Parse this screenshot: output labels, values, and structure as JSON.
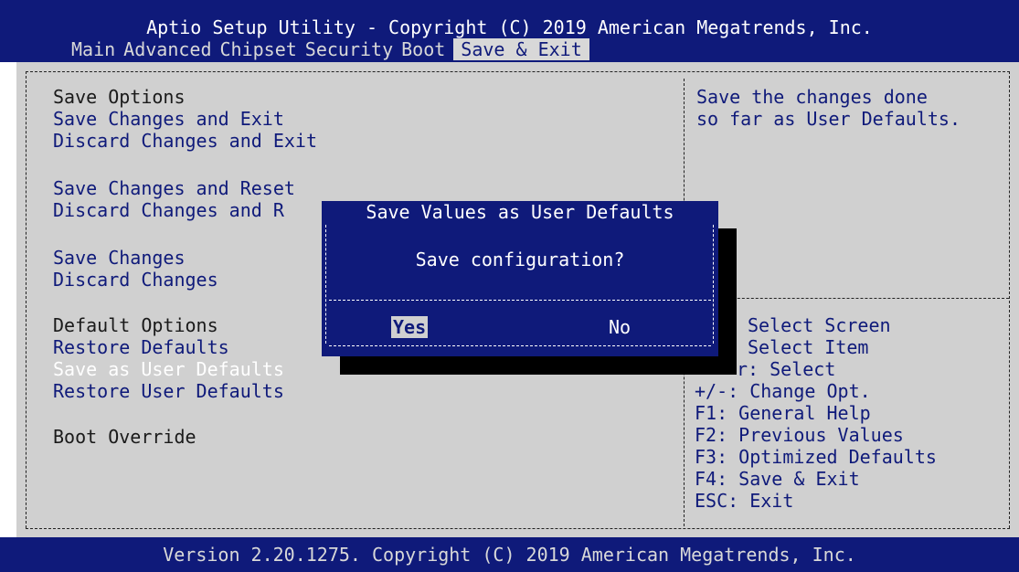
{
  "header": {
    "title": "Aptio Setup Utility - Copyright (C) 2019 American Megatrends, Inc.",
    "tabs": [
      "Main",
      "Advanced",
      "Chipset",
      "Security",
      "Boot",
      "Save & Exit"
    ],
    "active_tab": "Save & Exit"
  },
  "options": {
    "save_options": "Save Options",
    "save_changes_exit": "Save Changes and Exit",
    "discard_changes_exit": "Discard Changes and Exit",
    "save_changes_reset": "Save Changes and Reset",
    "discard_changes_reset": "Discard Changes and R",
    "save_changes": "Save Changes",
    "discard_changes": "Discard Changes",
    "default_options": "Default Options",
    "restore_defaults": "Restore Defaults",
    "save_user_defaults": "Save as User Defaults",
    "restore_user_defaults": "Restore User Defaults",
    "boot_override": "Boot Override"
  },
  "help": {
    "line1": "Save the changes done",
    "line2": "so far as User Defaults."
  },
  "keys": {
    "select_screen": "Select Screen",
    "select_item": "Select Item",
    "select": "r: Select",
    "change_opt": "+/-: Change Opt.",
    "general_help": "F1: General Help",
    "previous_values": "F2: Previous Values",
    "optimized_defaults": "F3: Optimized Defaults",
    "save_exit": "F4: Save & Exit",
    "esc_exit": "ESC: Exit"
  },
  "dialog": {
    "title": "Save Values as User Defaults",
    "message": "Save configuration?",
    "yes": "Yes",
    "no": "No"
  },
  "footer": {
    "version": "Version 2.20.1275. Copyright (C) 2019 American Megatrends, Inc."
  },
  "colors": {
    "bios_blue": "#0F1A7A",
    "panel_gray": "#D0D0D0",
    "highlight_white": "#FFFFFF"
  }
}
